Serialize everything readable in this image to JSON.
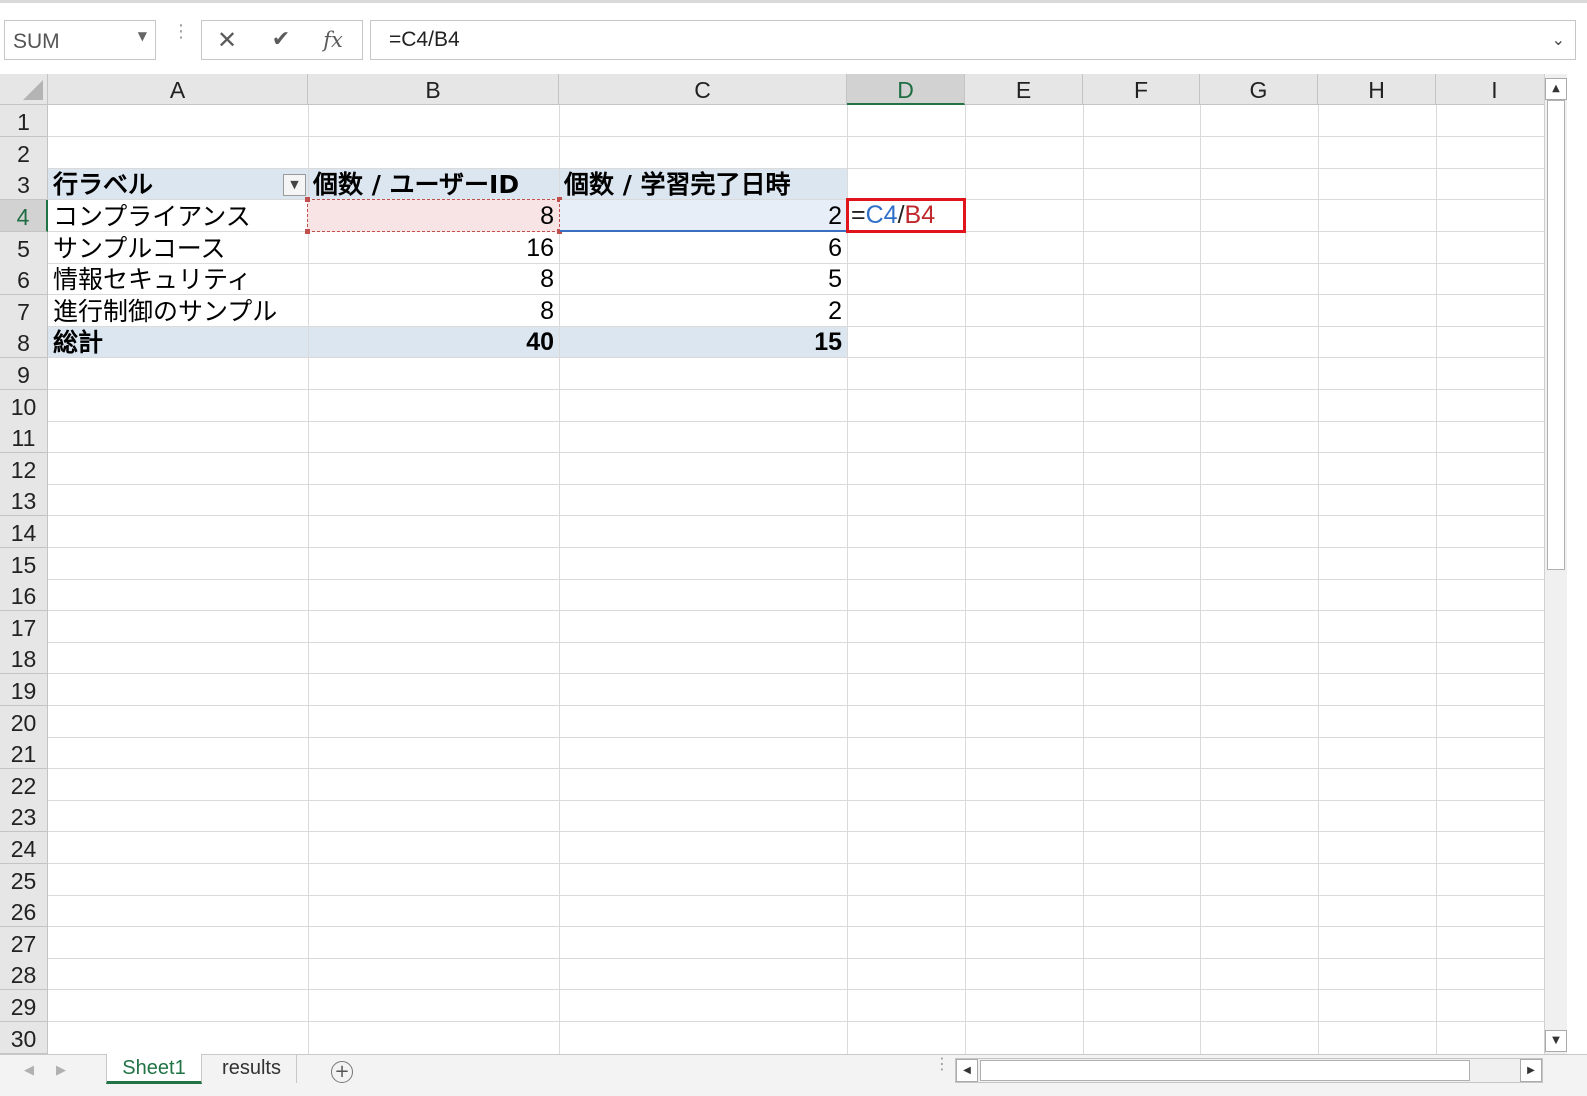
{
  "formula_bar": {
    "name_box": "SUM",
    "cancel_icon": "✕",
    "enter_icon": "✔",
    "fx_label": "fx",
    "formula": "=C4/B4"
  },
  "columns": [
    "A",
    "B",
    "C",
    "D",
    "E",
    "F",
    "G",
    "H",
    "I"
  ],
  "active_column": "D",
  "rows": [
    "1",
    "2",
    "3",
    "4",
    "5",
    "6",
    "7",
    "8",
    "9",
    "10",
    "11",
    "12",
    "13",
    "14",
    "15",
    "16",
    "17",
    "18",
    "19",
    "20",
    "21",
    "22",
    "23",
    "24",
    "25",
    "26",
    "27",
    "28",
    "29",
    "30"
  ],
  "active_row": "4",
  "pivot": {
    "header": {
      "row_label": "行ラベル",
      "count_user": "個数 / ユーザーID",
      "count_completed": "個数 / 学習完了日時"
    },
    "rows": [
      {
        "label": "コンプライアンス",
        "b": "8",
        "c": "2"
      },
      {
        "label": "サンプルコース",
        "b": "16",
        "c": "6"
      },
      {
        "label": "情報セキュリティ",
        "b": "8",
        "c": "5"
      },
      {
        "label": "進行制御のサンプル",
        "b": "8",
        "c": "2"
      }
    ],
    "total": {
      "label": "総計",
      "b": "40",
      "c": "15"
    }
  },
  "active_cell": {
    "address": "D4",
    "formula_parts": {
      "eq": "=",
      "c4": "C4",
      "div": "/",
      "b4": "B4"
    }
  },
  "sheets": [
    {
      "name": "Sheet1",
      "active": true
    },
    {
      "name": "results",
      "active": false
    }
  ],
  "icons": {
    "add_sheet": "plus-circle-icon",
    "filter": "dropdown-filter-icon",
    "expand": "chevron-down-icon"
  },
  "colors": {
    "accent_green": "#217346",
    "ref_blue": "#2f6fc8",
    "ref_red": "#c0282d",
    "active_border": "#e0151b",
    "pivot_band": "#dce6f1"
  }
}
